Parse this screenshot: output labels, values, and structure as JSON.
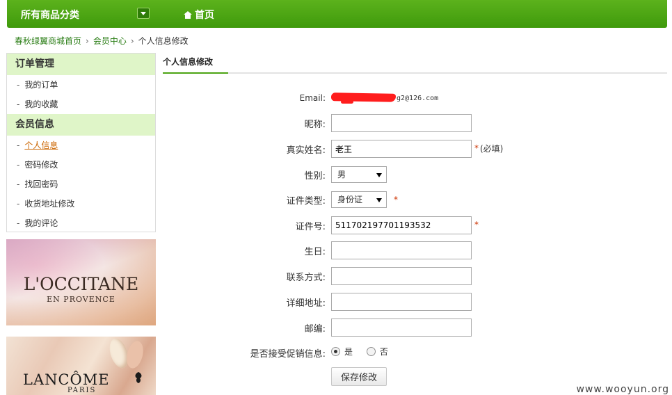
{
  "nav": {
    "category_title": "所有商品分类",
    "home_label": "首页"
  },
  "breadcrumb": {
    "items": [
      "春秋绿翼商城首页",
      "会员中心"
    ],
    "current": "个人信息修改"
  },
  "sidebar": {
    "sections": [
      {
        "title": "订单管理",
        "items": [
          "我的订单",
          "我的收藏"
        ]
      },
      {
        "title": "会员信息",
        "items": [
          "个人信息",
          "密码修改",
          "找回密码",
          "收货地址修改",
          "我的评论"
        ]
      }
    ],
    "active_item": "个人信息",
    "bullet": "-"
  },
  "banners": {
    "occitane": {
      "name": "L'OCCITANE",
      "sub": "EN PROVENCE"
    },
    "lancome": {
      "name": "LANCÔME",
      "sub": "PARIS"
    }
  },
  "main": {
    "tab_label": "个人信息修改",
    "form": {
      "email_label": "Email:",
      "email_value_visible": "g2@126.com",
      "nickname_label": "昵称:",
      "nickname_value": "",
      "realname_label": "真实姓名:",
      "realname_value": "老王",
      "required_mark": "*",
      "required_note": "(必填)",
      "gender_label": "性别:",
      "gender_value": "男",
      "id_type_label": "证件类型:",
      "id_type_value": "身份证",
      "id_number_label": "证件号:",
      "id_number_value": "511702197701193532",
      "birthday_label": "生日:",
      "birthday_value": "",
      "contact_label": "联系方式:",
      "contact_value": "",
      "address_label": "详细地址:",
      "address_value": "",
      "zipcode_label": "邮编:",
      "zipcode_value": "",
      "promo_label": "是否接受促销信息:",
      "promo_yes": "是",
      "promo_no": "否",
      "promo_selected": "是",
      "save_label": "保存修改"
    }
  },
  "watermark": "www.wooyun.org",
  "colors": {
    "nav_green": "#4ca313",
    "side_header_bg": "#dff5c8",
    "link_green": "#2a7d15",
    "active_orange": "#cc6600",
    "required_red": "#cc3300"
  }
}
